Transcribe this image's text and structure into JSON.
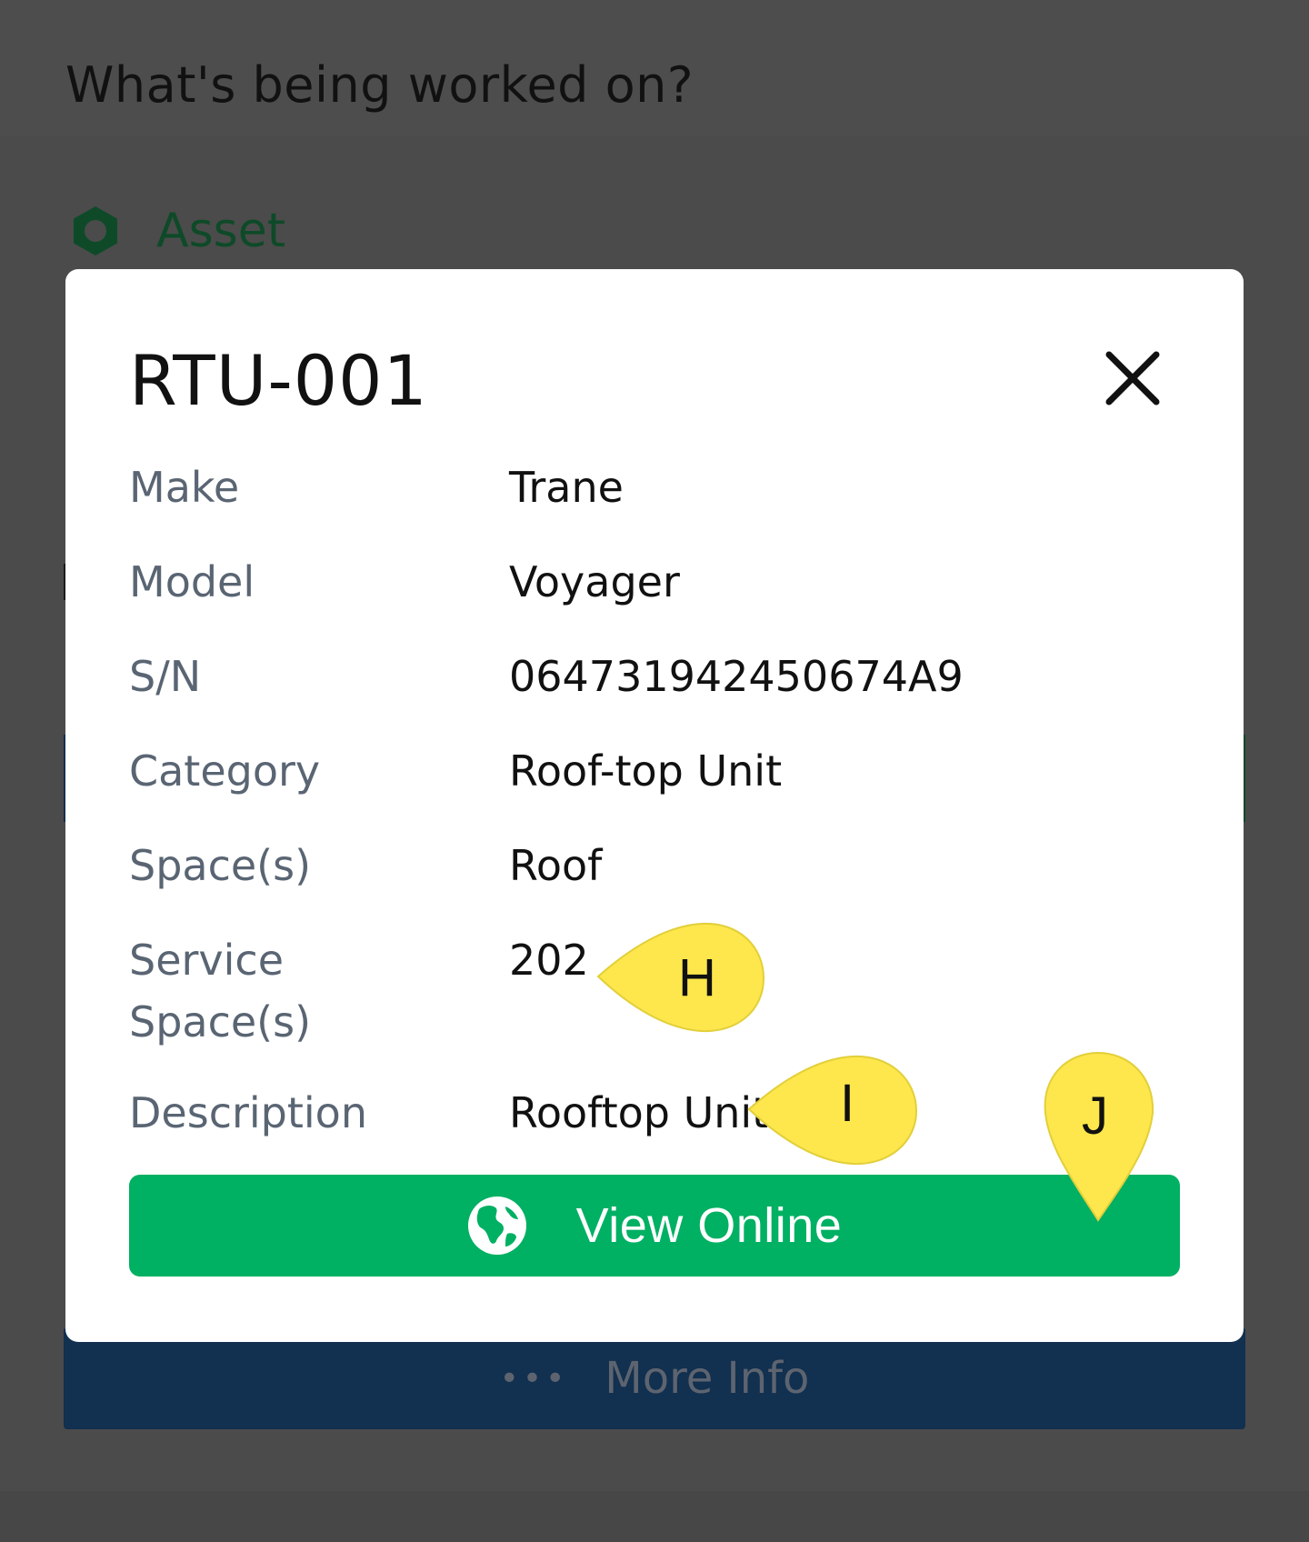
{
  "background": {
    "question": "What's being worked on?",
    "asset_label": "Asset",
    "more_info_dots": "•••",
    "more_info_label": "More Info"
  },
  "modal": {
    "title": "RTU-001",
    "details": [
      {
        "label": "Make",
        "value": "Trane"
      },
      {
        "label": "Model",
        "value": "Voyager"
      },
      {
        "label": "S/N",
        "value": "064731942450674A9"
      },
      {
        "label": "Category",
        "value": "Roof-top Unit"
      },
      {
        "label": "Space(s)",
        "value": "Roof"
      },
      {
        "label": "Service Space(s)",
        "value": "202"
      },
      {
        "label": "Description",
        "value": "Rooftop Unit"
      }
    ],
    "view_online_label": "View Online"
  },
  "callouts": {
    "h": "H",
    "i": "I",
    "j": "J",
    "color": "#fde74c"
  },
  "colors": {
    "accent_green": "#00b063",
    "navy": "#12304f",
    "asset_green": "#0e4a28"
  },
  "icons": {
    "close": "close-icon",
    "globe": "globe-icon",
    "asset": "hexagon-icon"
  }
}
